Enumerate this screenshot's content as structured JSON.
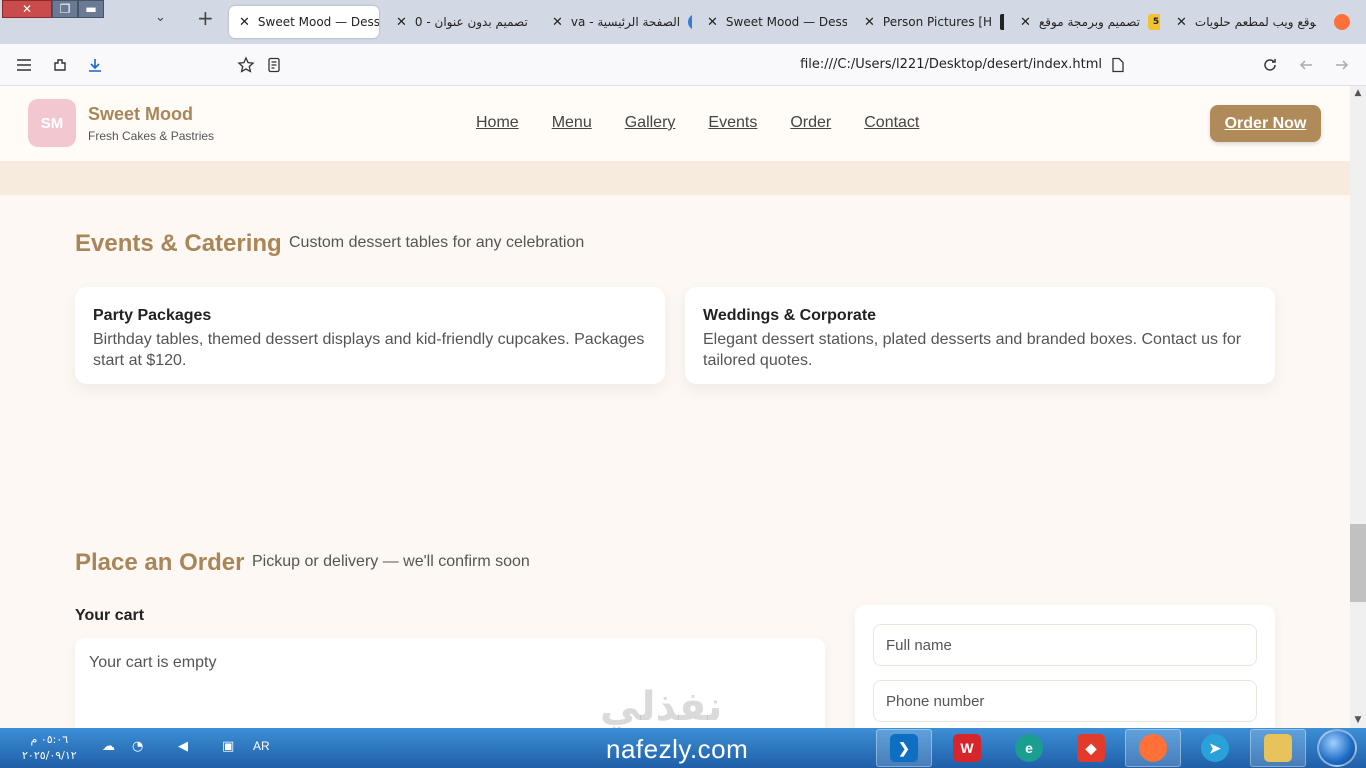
{
  "browser": {
    "tabs": [
      {
        "title": "Sweet Mood — Desse",
        "active": true
      },
      {
        "title": "تصميم بدون عنوان - 0",
        "icon": "canva-icon"
      },
      {
        "title": "الصفحة الرئيسية - va",
        "icon": "canva-icon"
      },
      {
        "title": "Sweet Mood — Desse"
      },
      {
        "title": "Person Pictures [H"
      },
      {
        "title": "تصميم وبرمجة موقع",
        "icon": "badge-5-icon",
        "badge": "5"
      },
      {
        "title": "موقع ويب لمطعم حلويات",
        "icon": "chatgpt-icon"
      }
    ],
    "url": "file:///C:/Users/l221/Desktop/desert/index.html"
  },
  "site": {
    "logo_initials": "SM",
    "brand_name": "Sweet Mood",
    "brand_tagline": "Fresh Cakes & Pastries",
    "nav": [
      "Home",
      "Menu",
      "Gallery",
      "Events",
      "Order",
      "Contact"
    ],
    "cta": "Order Now",
    "events": {
      "title": "Events & Catering",
      "subtitle": "Custom dessert tables for any celebration",
      "cards": [
        {
          "title": "Party Packages",
          "text": "Birthday tables, themed dessert displays and kid-friendly cupcakes. Packages start at $120."
        },
        {
          "title": "Weddings & Corporate",
          "text": "Elegant dessert stations, plated desserts and branded boxes. Contact us for tailored quotes."
        }
      ]
    },
    "order": {
      "title": "Place an Order",
      "subtitle": "Pickup or delivery — we'll confirm soon",
      "cart_label": "Your cart",
      "cart_empty": "Your cart is empty",
      "full_name_placeholder": "Full name",
      "phone_placeholder": "Phone number"
    }
  },
  "watermark": {
    "arabic": "نفذلي",
    "latin": "nafezly.com"
  },
  "taskbar": {
    "time": "٠٥:٠٦ م",
    "date": "٢٠٢٥/٠٩/١٢",
    "language": "AR"
  },
  "colors": {
    "accent": "#b08a58",
    "logo_bg": "#f3c7cf",
    "page_bg": "#fdf8f3",
    "taskbar": "#2a73c0"
  }
}
